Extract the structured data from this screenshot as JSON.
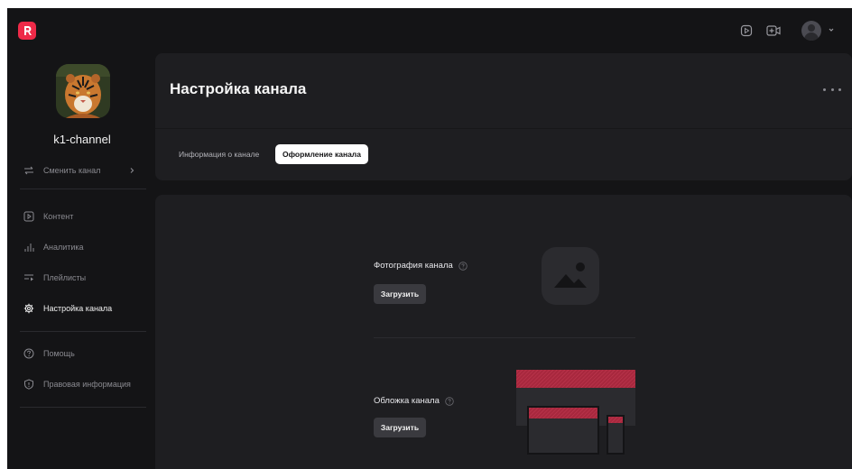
{
  "sidebar": {
    "channel_name": "k1-channel",
    "switch_channel_label": "Сменить канал",
    "nav": [
      {
        "label": "Контент",
        "icon": "play-square-icon",
        "active": false
      },
      {
        "label": "Аналитика",
        "icon": "bar-chart-icon",
        "active": false
      },
      {
        "label": "Плейлисты",
        "icon": "playlist-icon",
        "active": false
      },
      {
        "label": "Настройка канала",
        "icon": "gear-icon",
        "active": true
      }
    ],
    "secondary": [
      {
        "label": "Помощь",
        "icon": "help-circle-icon"
      },
      {
        "label": "Правовая информация",
        "icon": "shield-icon"
      }
    ]
  },
  "header": {
    "title": "Настройка канала",
    "tabs": [
      {
        "label": "Информация о канале",
        "active": false
      },
      {
        "label": "Оформление канала",
        "active": true
      }
    ]
  },
  "content": {
    "photo": {
      "label": "Фотография канала",
      "upload_label": "Загрузить"
    },
    "cover": {
      "label": "Обложка канала",
      "upload_label": "Загрузить"
    }
  },
  "colors": {
    "brand": "#ee2a48",
    "background": "#141416",
    "card": "#1e1e21",
    "cover_accent": "#a8283e"
  }
}
